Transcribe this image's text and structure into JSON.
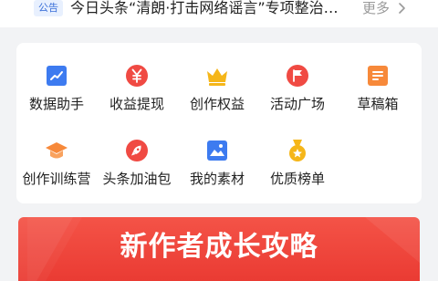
{
  "notice": {
    "badge": "公告",
    "text": "今日头条“清朗·打击网络谣言”专项整治…",
    "more_label": "更多"
  },
  "tools": [
    {
      "label": "数据助手",
      "icon": "chart-icon",
      "color": "#3d7bf0"
    },
    {
      "label": "收益提现",
      "icon": "yen-icon",
      "color": "#f04a43"
    },
    {
      "label": "创作权益",
      "icon": "crown-icon",
      "color": "#f5b619"
    },
    {
      "label": "活动广场",
      "icon": "flag-icon",
      "color": "#f04a43"
    },
    {
      "label": "草稿箱",
      "icon": "document-icon",
      "color": "#f7893a"
    },
    {
      "label": "创作训练营",
      "icon": "graduation-cap-icon",
      "color": "#f7893a"
    },
    {
      "label": "头条加油包",
      "icon": "rocket-icon",
      "color": "#f04a43"
    },
    {
      "label": "我的素材",
      "icon": "image-icon",
      "color": "#3d7bf0"
    },
    {
      "label": "优质榜单",
      "icon": "medal-icon",
      "color": "#f5b619"
    }
  ],
  "banner": {
    "title": "新作者成长攻略"
  }
}
